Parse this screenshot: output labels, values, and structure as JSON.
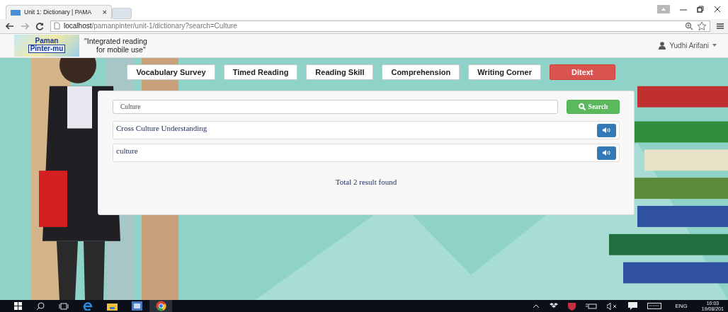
{
  "browser": {
    "tab_title": "Unit 1: Dictionary | PAMA",
    "tab_close": "×",
    "url_host": "localhost",
    "url_path": "/pamanpinter/unit-1/dictionary?search=Culture"
  },
  "header": {
    "logo_top": "Paman",
    "logo_bottom": "Pinter-mu",
    "tagline_1": "\"Integrated reading",
    "tagline_2": "for mobile use\"",
    "user": "Yudhi Arifani"
  },
  "nav": [
    {
      "label": "Vocabulary Survey",
      "selected": false
    },
    {
      "label": "Timed Reading",
      "selected": false
    },
    {
      "label": "Reading Skill",
      "selected": false
    },
    {
      "label": "Comprehension",
      "selected": false
    },
    {
      "label": "Writing Corner",
      "selected": false
    },
    {
      "label": "Ditext",
      "selected": true
    }
  ],
  "search": {
    "value": "Culture",
    "button": "Search"
  },
  "results": [
    {
      "term": "Cross Culture Understanding"
    },
    {
      "term": "culture"
    }
  ],
  "summary": "Total 2 result found",
  "taskbar": {
    "language": "ENG",
    "time": "10:03",
    "date": "19/08/201"
  }
}
